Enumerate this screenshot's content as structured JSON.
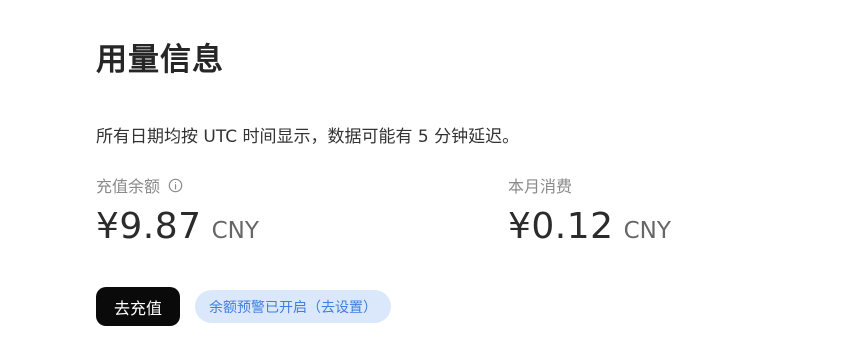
{
  "page": {
    "title": "用量信息",
    "notice": "所有日期均按 UTC 时间显示，数据可能有 5 分钟延迟。"
  },
  "balance": {
    "label": "充值余额",
    "info_icon": "info-circle-icon",
    "amount": "¥9.87",
    "currency": "CNY"
  },
  "monthly": {
    "label": "本月消费",
    "amount": "¥0.12",
    "currency": "CNY"
  },
  "actions": {
    "topup_label": "去充值",
    "alert_label": "余额预警已开启（去设置）"
  },
  "colors": {
    "button_bg": "#0a0a0a",
    "pill_bg": "#dbe8fb",
    "pill_text": "#3f7de0"
  }
}
